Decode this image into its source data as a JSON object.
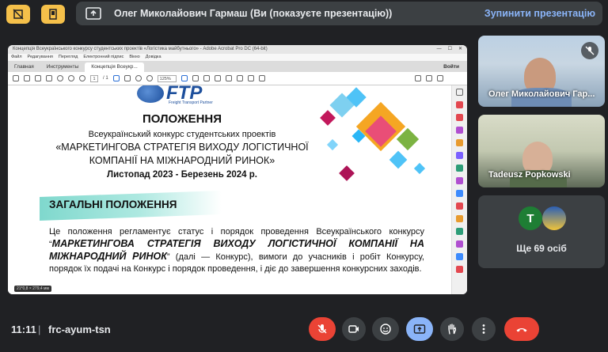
{
  "presentation_banner": {
    "text": "Олег Миколайович Гармаш (Ви (показуєте презентацію))",
    "stop_label": "Зупинити презентацію"
  },
  "acrobat": {
    "window_title": "Концепція Всеукраїнського конкурсу студентських проектів «Логістика майбутнього» - Adobe Acrobat Pro DC (64-bit)",
    "menu": [
      "Файл",
      "Редагування",
      "Перегляд",
      "Електронний підпис",
      "Вікно",
      "Довідка"
    ],
    "tabs": [
      "Главная",
      "Инструменты",
      "Концепція Всеукр..."
    ],
    "login_label": "Войти",
    "page_current": "1",
    "page_total": "/ 1",
    "zoom": "125%",
    "status_size": "21*0,8 × 279,4 мм"
  },
  "document": {
    "logo_text": "FTP",
    "logo_sub": "Freight Transport Partner",
    "title": "ПОЛОЖЕННЯ",
    "subtitle": "Всеукраїнський конкурс студентських проектів",
    "contest_name_1": "«МАРКЕТИНГОВА СТРАТЕГІЯ ВИХОДУ ЛОГІСТИЧНОЇ",
    "contest_name_2": "КОМПАНІЇ НА МІЖНАРОДНИЙ РИНОК»",
    "period": "Листопад 2023 - Березень 2024 р.",
    "section_title": "ЗАГАЛЬНІ ПОЛОЖЕННЯ",
    "para_1a": "Це положення регламентує статус і порядок проведення Всеукраїнського конкурсу",
    "para_1b": "“",
    "para_1c": "МАРКЕТИНГОВА СТРАТЕГІЯ ВИХОДУ ЛОГІСТИЧНОЇ КОМПАНІЇ НА МІЖНАРОДНИЙ РИНОК",
    "para_1d": "” (далі — Конкурс), вимоги до учасників і робіт Конкурсу, порядок їх подачі на Конкурс і порядок проведення, і діє до завершення конкурсних заходів."
  },
  "participants": [
    {
      "name": "Олег Миколайович Гар...",
      "muted": true
    },
    {
      "name": "Tadeusz Popkowski",
      "muted": false
    }
  ],
  "others": {
    "avatar_letter": "T",
    "count_label": "Ще 69 осіб"
  },
  "bottom": {
    "time": "11:11",
    "separator": "|",
    "meeting_code": "frc-ayum-tsn"
  },
  "colors": {
    "top_icon": "#f5c04a",
    "accent_blue": "#8ab4f8",
    "hangup": "#ea4335",
    "mic_off": "#ea4335",
    "present_active": "#8ab4f8"
  }
}
